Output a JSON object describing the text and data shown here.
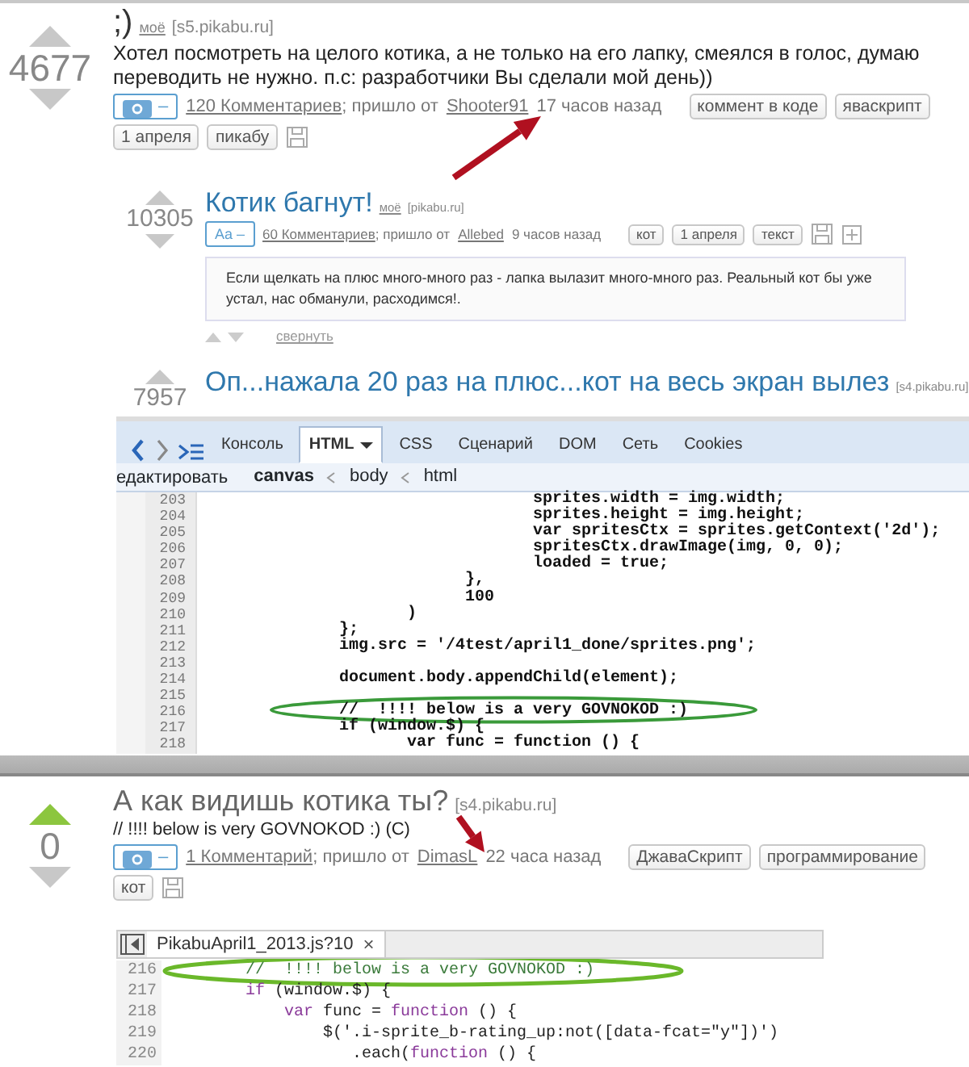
{
  "panels": [
    {
      "kind": "feed",
      "posts": [
        {
          "rating": "4677",
          "voted_up": false,
          "title": ";)",
          "mine": "моё",
          "source": "[s5.pikabu.ru]",
          "text": "Хотел посмотреть на целого котика, а не только на его лапку, смеялся в голос, думаю переводить не нужно. п.с: разработчики Вы сделали мой день))",
          "media": {
            "kind": "photo",
            "label": "–"
          },
          "comments": "120 Комментариев",
          "via": "; пришло от",
          "author": "Shooter91",
          "time": "17 часов назад",
          "tags": [
            "коммент в коде",
            "яваскрипт",
            "1 апреля",
            "пикабу"
          ],
          "icons": [
            {
              "kind": "save"
            }
          ]
        }
      ]
    },
    {
      "kind": "classic_feed",
      "posts": [
        {
          "rating": "10305",
          "voted_up": false,
          "title": "Котик багнут!",
          "mine": "моё",
          "source": "[pikabu.ru]",
          "media": {
            "kind": "text",
            "label": "Aa –"
          },
          "comments": "60 Комментариев",
          "via": "; пришло от",
          "author": "Allebed",
          "time": "9 часов назад",
          "tags": [
            "кот",
            "1 апреля",
            "текст"
          ],
          "icons": [
            {
              "kind": "save"
            },
            {
              "kind": "expand"
            }
          ],
          "comment": "Если щелкать на плюс много-много раз - лапка вылазит много-много раз. Реальный кот бы уже устал, нас обманули, расходимся!.",
          "collapse": "свернуть"
        },
        {
          "rating": "7957",
          "voted_up": false,
          "title": "Оп...нажала 20 раз на плюс...кот на весь экран вылез",
          "source": "[s4.pikabu.ru]"
        }
      ]
    },
    {
      "kind": "devtools",
      "tabs": [
        {
          "label": "Консоль",
          "selected": false
        },
        {
          "label": "HTML",
          "selected": true
        },
        {
          "label": "CSS",
          "selected": false
        },
        {
          "label": "Сценарий",
          "selected": false
        },
        {
          "label": "DOM",
          "selected": false
        },
        {
          "label": "Сеть",
          "selected": false
        },
        {
          "label": "Cookies",
          "selected": false
        }
      ],
      "edit_label": "едактировать",
      "breadcrumbs": [
        {
          "label": "canvas",
          "selected": true
        },
        {
          "label": "body",
          "selected": false
        },
        {
          "label": "html",
          "selected": false
        }
      ],
      "lines": [
        {
          "number": "203",
          "code": "                                  sprites.width = img.width;"
        },
        {
          "number": "204",
          "code": "                                  sprites.height = img.height;"
        },
        {
          "number": "205",
          "code": "                                  var spritesCtx = sprites.getContext('2d');"
        },
        {
          "number": "206",
          "code": "                                  spritesCtx.drawImage(img, 0, 0);"
        },
        {
          "number": "207",
          "code": "                                  loaded = true;"
        },
        {
          "number": "208",
          "code": "                           },"
        },
        {
          "number": "209",
          "code": "                           100"
        },
        {
          "number": "210",
          "code": "                     )"
        },
        {
          "number": "211",
          "code": "              };"
        },
        {
          "number": "212",
          "code": "              img.src = '/4test/april1_done/sprites.png';"
        },
        {
          "number": "213"
        },
        {
          "number": "214",
          "code": "              document.body.appendChild(element);"
        },
        {
          "number": "215"
        },
        {
          "number": "216",
          "code": "              //  !!!! below is a very GOVNOKOD :)"
        },
        {
          "number": "217",
          "code": "              if (window.$) {"
        },
        {
          "number": "218",
          "code": "                     var func = function () {"
        }
      ]
    },
    {
      "kind": "feed",
      "posts": [
        {
          "rating": "0",
          "voted_up": true,
          "title": "А как видишь котика ты?",
          "source": "[s4.pikabu.ru]",
          "text": "// !!!! below is very GOVNOKOD :) (C)",
          "media": {
            "kind": "photo",
            "label": "–"
          },
          "comments": "1 Комментарий",
          "via": "; пришло от",
          "author": "DimasL",
          "time": "22 часа назад",
          "tags": [
            "ДжаваСкрипт",
            "программирование",
            "кот"
          ],
          "icons": [
            {
              "kind": "save"
            }
          ]
        }
      ]
    },
    {
      "kind": "editor",
      "file_tab": "PikabuApril1_2013.js?10",
      "close": "×",
      "lines": [
        {
          "number": "216",
          "tokens": [
            {
              "kind": "comment",
              "text": "        //  !!!! below is a very GOVNOKOD :)"
            }
          ]
        },
        {
          "number": "217",
          "tokens": [
            {
              "kind": "keyword",
              "text": "        if"
            },
            {
              "kind": "plain",
              "text": " (window.$) {"
            }
          ]
        },
        {
          "number": "218",
          "tokens": [
            {
              "kind": "keyword",
              "text": "            var"
            },
            {
              "kind": "plain",
              "text": " func = "
            },
            {
              "kind": "keyword",
              "text": "function"
            },
            {
              "kind": "plain",
              "text": " () {"
            }
          ]
        },
        {
          "number": "219",
          "tokens": [
            {
              "kind": "plain",
              "text": "                $('.i-sprite_b-rating_up:not([data-fcat=\"y\"])')"
            }
          ]
        },
        {
          "number": "220",
          "tokens": [
            {
              "kind": "plain",
              "text": "                   .each("
            },
            {
              "kind": "keyword",
              "text": "function"
            },
            {
              "kind": "plain",
              "text": " () {"
            }
          ]
        }
      ]
    }
  ]
}
